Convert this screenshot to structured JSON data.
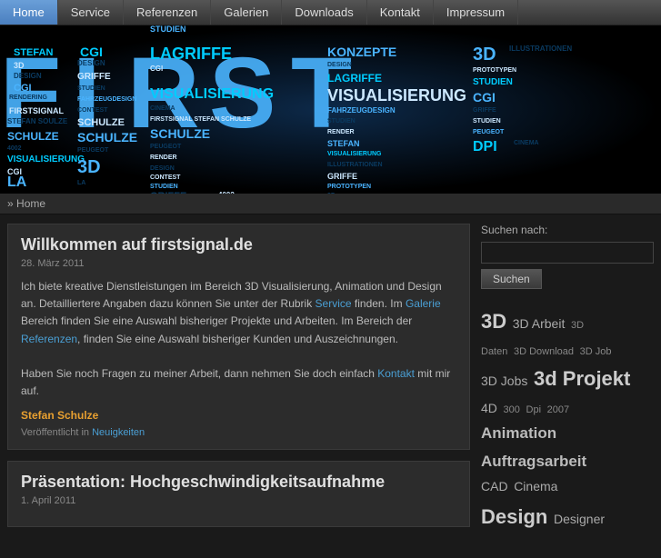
{
  "nav": {
    "items": [
      {
        "label": "Home",
        "active": true
      },
      {
        "label": "Service",
        "active": false
      },
      {
        "label": "Referenzen",
        "active": false
      },
      {
        "label": "Galerien",
        "active": false
      },
      {
        "label": "Downloads",
        "active": false
      },
      {
        "label": "Kontakt",
        "active": false
      },
      {
        "label": "Impressum",
        "active": false
      }
    ]
  },
  "breadcrumb": {
    "prefix": "»",
    "label": "Home"
  },
  "posts": [
    {
      "title": "Willkommen auf firstsignal.de",
      "date": "28. März 2011",
      "body_p1": "Ich biete kreative Dienstleistungen im Bereich 3D Visualisierung, Animation und Design an. Detailliertere Angaben dazu können Sie unter der Rubrik ",
      "link1_text": "Service",
      "body_p1b": " finden. Im ",
      "link2_text": "Galerie",
      "body_p1c": " Bereich finden Sie eine Auswahl bisheriger Projekte und Arbeiten. Im Bereich der ",
      "link3_text": "Referenzen",
      "body_p1d": ", finden Sie eine Auswahl bisheriger Kunden und Auszeichnungen.",
      "body_p2_pre": "Haben Sie noch Fragen zu meiner Arbeit, dann nehmen Sie doch einfach ",
      "link4_text": "Kontakt",
      "body_p2_post": " mit mir auf.",
      "author": "Stefan Schulze",
      "cat_pre": "Veröffentlicht in ",
      "cat_link": "Neuigkeiten"
    },
    {
      "title": "Präsentation: Hochgeschwindigkeitsaufnahme",
      "date": "1. April 2011"
    }
  ],
  "sidebar": {
    "search_label": "Suchen nach:",
    "search_placeholder": "",
    "search_btn": "Suchen",
    "tags": [
      {
        "label": "3D",
        "size": "xl"
      },
      {
        "label": "3D Arbeit",
        "size": "md"
      },
      {
        "label": "3D",
        "size": "sm"
      },
      {
        "label": "Daten",
        "size": "sm"
      },
      {
        "label": "3D Download",
        "size": "sm"
      },
      {
        "label": "3D Job",
        "size": "sm"
      },
      {
        "label": "3D Jobs",
        "size": "md"
      },
      {
        "label": "3d Projekt",
        "size": "xl"
      },
      {
        "label": "4D",
        "size": "md"
      },
      {
        "label": "300",
        "size": "sm"
      },
      {
        "label": "Dpi",
        "size": "sm"
      },
      {
        "label": "2007",
        "size": "sm"
      },
      {
        "label": "Animation",
        "size": "lg"
      },
      {
        "label": "Auftragsarbeit",
        "size": "lg"
      },
      {
        "label": "CAD",
        "size": "md"
      },
      {
        "label": "Cinema",
        "size": "md"
      },
      {
        "label": "Design",
        "size": "xl"
      },
      {
        "label": "Designer",
        "size": "md"
      }
    ]
  }
}
